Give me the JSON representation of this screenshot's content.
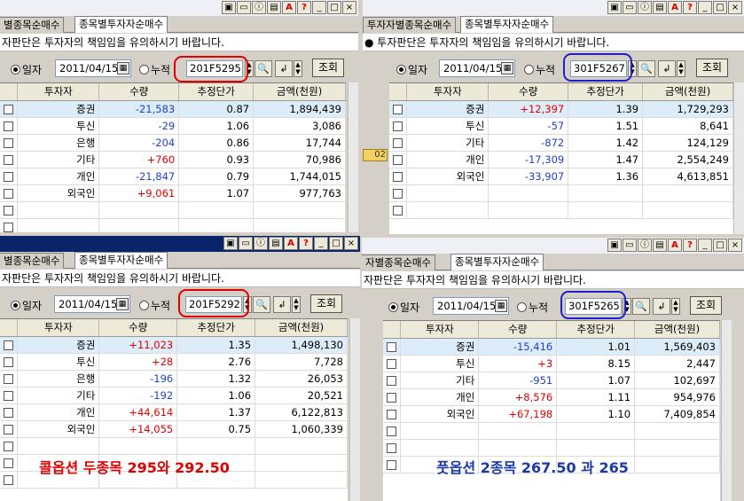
{
  "common": {
    "tab_inactive": "투자자별종목순매수",
    "tab_active": "종목별투자자순매수",
    "notice": "투자판단은 투자자의 책임임을 유의하시기 바랍니다.",
    "radio_daily": "일자",
    "radio_cumulative": "누적",
    "date": "2011/04/15",
    "query_label": "조회",
    "headers": [
      "투자자",
      "수량",
      "추정단가",
      "금액(천원)"
    ],
    "title_buttons": [
      "▣",
      "▭",
      "ⓘ",
      "▤",
      "A",
      "?",
      "_",
      "□",
      "×"
    ]
  },
  "panels": {
    "tl": {
      "tab_inactive_crop": "별종목순매수",
      "notice_crop": "자판단은 투자자의 책임임을 유의하시기 바랍니다.",
      "code": "201F5295",
      "rows": [
        {
          "investor": "증권",
          "qty": "-21,583",
          "price": "0.87",
          "amount": "1,894,439",
          "dir": "down"
        },
        {
          "investor": "투신",
          "qty": "-29",
          "price": "1.06",
          "amount": "3,086",
          "dir": "down"
        },
        {
          "investor": "은행",
          "qty": "-204",
          "price": "0.86",
          "amount": "17,744",
          "dir": "down"
        },
        {
          "investor": "기타",
          "qty": "+760",
          "price": "0.93",
          "amount": "70,986",
          "dir": "up"
        },
        {
          "investor": "개인",
          "qty": "-21,847",
          "price": "0.79",
          "amount": "1,744,015",
          "dir": "down"
        },
        {
          "investor": "외국인",
          "qty": "+9,061",
          "price": "1.07",
          "amount": "977,763",
          "dir": "up"
        }
      ]
    },
    "tr": {
      "tab_inactive_crop": "투자자별종목순매수",
      "notice_crop": "● 투자판단은 투자자의 책임임을 유의하시기 바랍니다.",
      "code": "301F5267",
      "rows": [
        {
          "investor": "증권",
          "qty": "+12,397",
          "price": "1.39",
          "amount": "1,729,293",
          "dir": "up"
        },
        {
          "investor": "투신",
          "qty": "-57",
          "price": "1.51",
          "amount": "8,641",
          "dir": "down"
        },
        {
          "investor": "기타",
          "qty": "-872",
          "price": "1.42",
          "amount": "124,129",
          "dir": "down"
        },
        {
          "investor": "개인",
          "qty": "-17,309",
          "price": "1.47",
          "amount": "2,554,249",
          "dir": "down"
        },
        {
          "investor": "외국인",
          "qty": "-33,907",
          "price": "1.36",
          "amount": "4,613,851",
          "dir": "down"
        }
      ]
    },
    "bl": {
      "tab_inactive_crop": "별종목순매수",
      "notice_crop": "자판단은 투자자의 책임임을 유의하시기 바랍니다.",
      "code": "201F5292",
      "rows": [
        {
          "investor": "증권",
          "qty": "+11,023",
          "price": "1.35",
          "amount": "1,498,130",
          "dir": "up"
        },
        {
          "investor": "투신",
          "qty": "+28",
          "price": "2.76",
          "amount": "7,728",
          "dir": "up"
        },
        {
          "investor": "은행",
          "qty": "-196",
          "price": "1.32",
          "amount": "26,053",
          "dir": "down"
        },
        {
          "investor": "기타",
          "qty": "-192",
          "price": "1.06",
          "amount": "20,521",
          "dir": "down"
        },
        {
          "investor": "개인",
          "qty": "+44,614",
          "price": "1.37",
          "amount": "6,122,813",
          "dir": "up"
        },
        {
          "investor": "외국인",
          "qty": "+14,055",
          "price": "0.75",
          "amount": "1,060,339",
          "dir": "up"
        }
      ]
    },
    "br": {
      "tab_inactive_crop": "자별종목순매수",
      "notice_crop": "자판단은 투자자의 책임임을 유의하시기 바랍니다.",
      "code": "301F5265",
      "rows": [
        {
          "investor": "증권",
          "qty": "-15,416",
          "price": "1.01",
          "amount": "1,569,403",
          "dir": "down"
        },
        {
          "investor": "투신",
          "qty": "+3",
          "price": "8.15",
          "amount": "2,447",
          "dir": "up"
        },
        {
          "investor": "기타",
          "qty": "-951",
          "price": "1.07",
          "amount": "102,697",
          "dir": "down"
        },
        {
          "investor": "개인",
          "qty": "+8,576",
          "price": "1.11",
          "amount": "954,976",
          "dir": "up"
        },
        {
          "investor": "외국인",
          "qty": "+67,198",
          "price": "1.10",
          "amount": "7,409,854",
          "dir": "up"
        }
      ]
    }
  },
  "annotations": {
    "call": "콜옵션 두종목 295와 292.50",
    "put": "풋옵션 2종목  267.50 과  265"
  },
  "side_chip": "02",
  "colors": {
    "up": "#e00000",
    "down": "#2040d0",
    "call_note": "#e00000",
    "put_note": "#1a3aa8"
  }
}
